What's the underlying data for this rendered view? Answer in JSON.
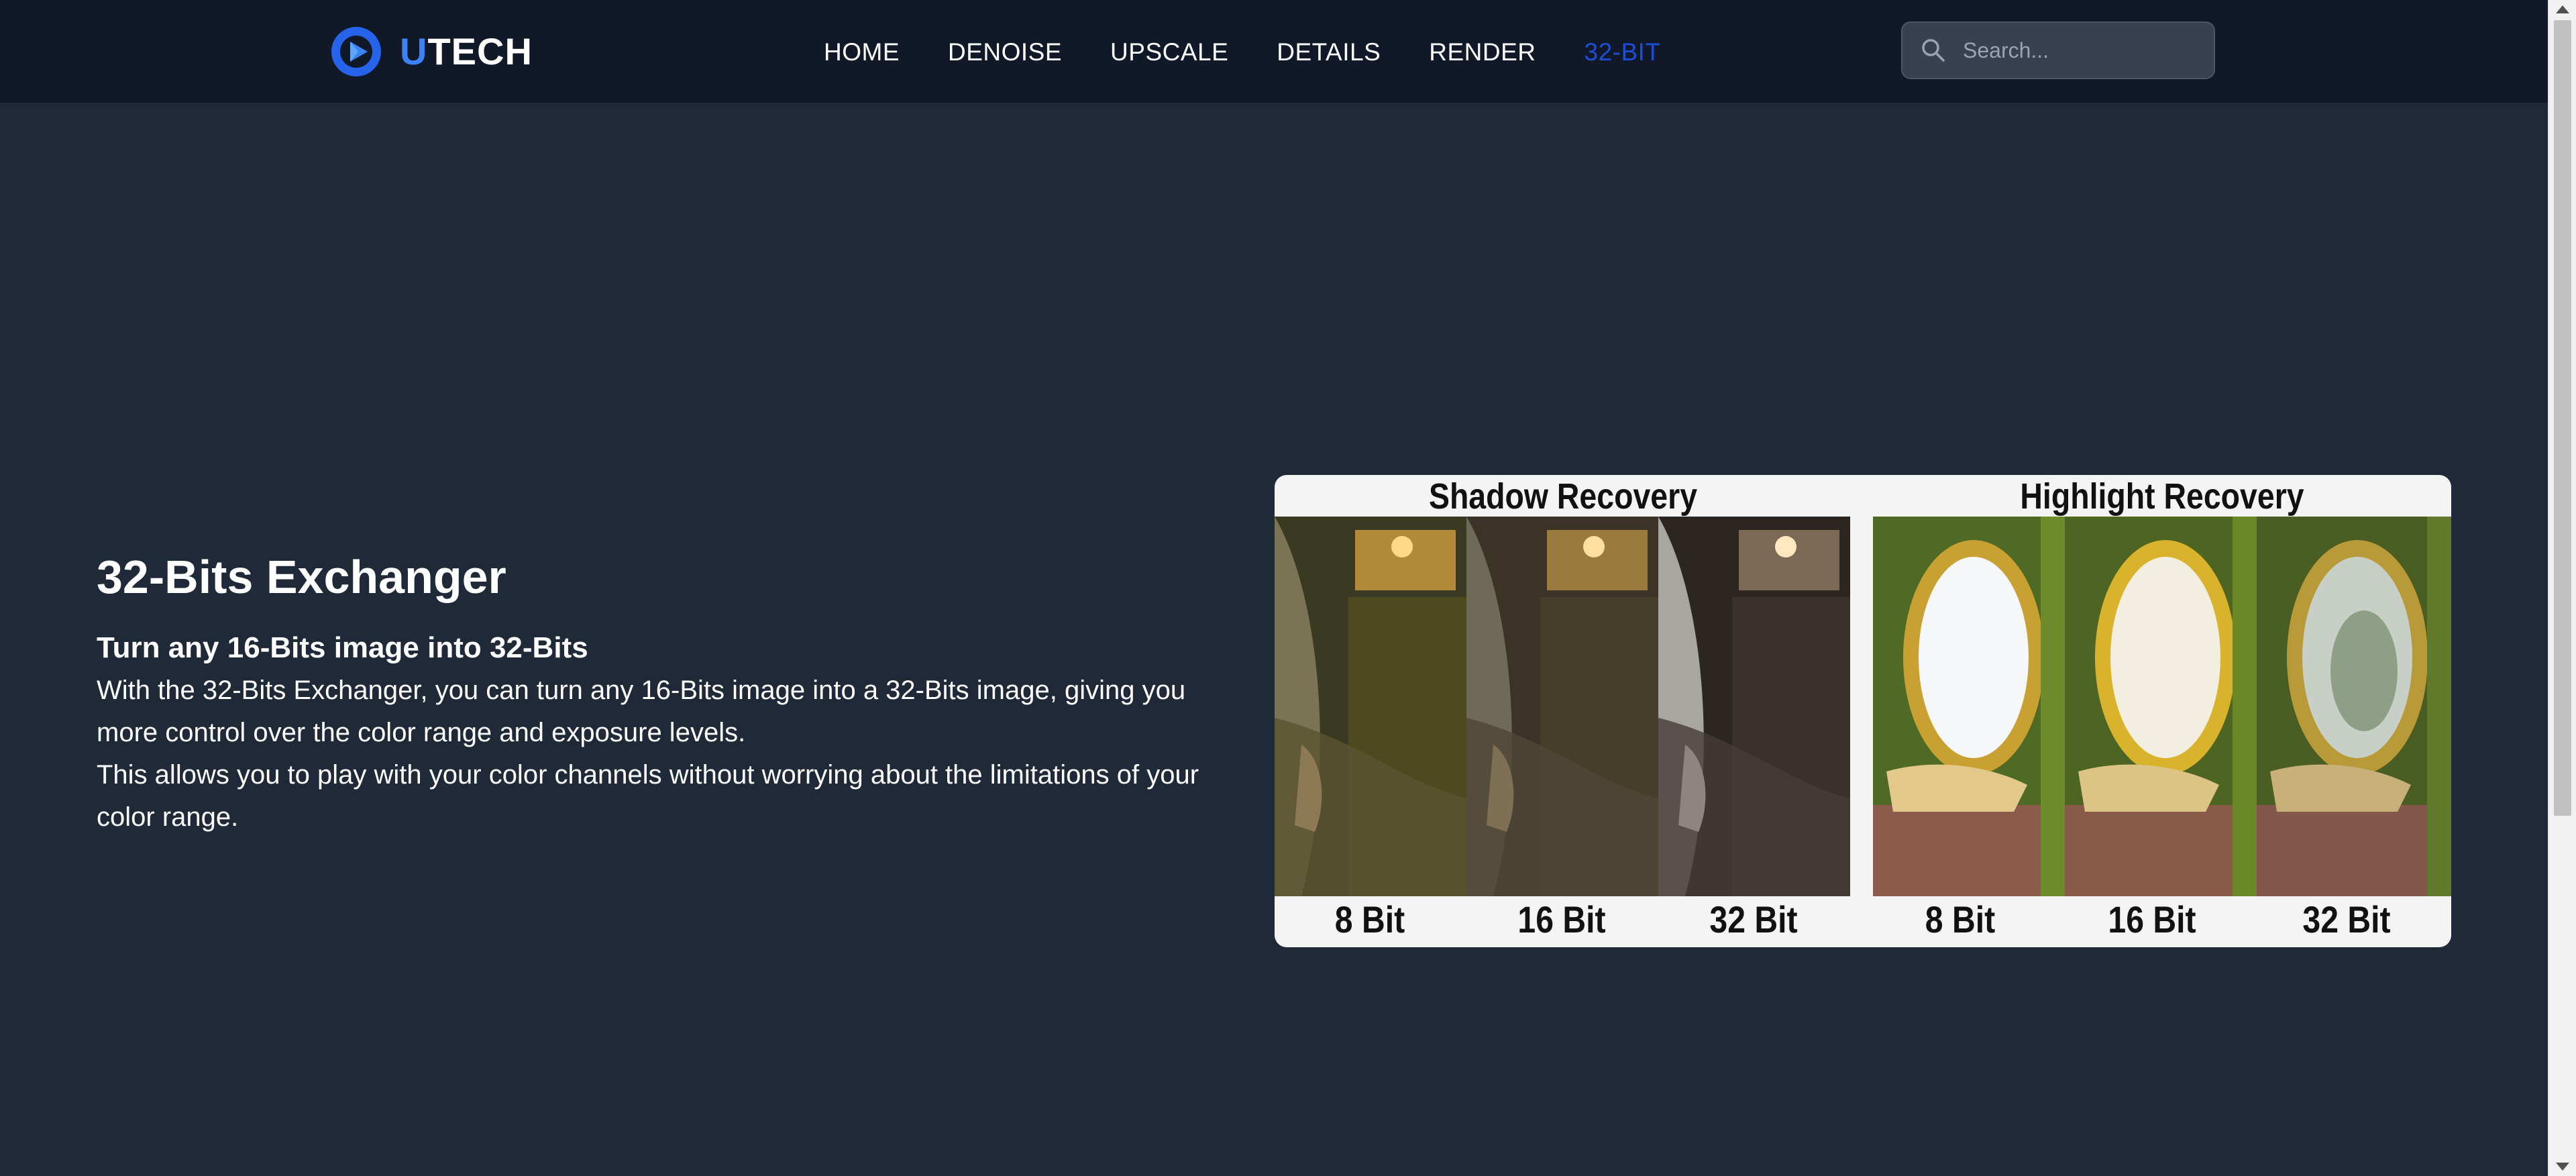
{
  "brand": {
    "initial": "U",
    "rest": "TECH"
  },
  "nav": {
    "items": [
      {
        "label": "HOME"
      },
      {
        "label": "DENOISE"
      },
      {
        "label": "UPSCALE"
      },
      {
        "label": "DETAILS"
      },
      {
        "label": "RENDER"
      },
      {
        "label": "32-BIT",
        "active": true
      }
    ]
  },
  "search": {
    "placeholder": "Search..."
  },
  "hero": {
    "title": "32-Bits Exchanger",
    "subtitle": "Turn any 16-Bits image into 32-Bits",
    "paragraph1": "With the 32-Bits Exchanger, you can turn any 16-Bits image into a 32-Bits image, giving you more control over the color range and exposure levels.",
    "paragraph2": "This allows you to play with your color channels without worrying about the limitations of your color range."
  },
  "figure": {
    "left_heading": "Shadow Recovery",
    "right_heading": "Highlight Recovery",
    "labels": [
      "8 Bit",
      "16 Bit",
      "32 Bit",
      "8 Bit",
      "16 Bit",
      "32 Bit"
    ]
  },
  "colors": {
    "page_bg": "#1f2937",
    "header_bg": "#111827",
    "accent": "#3b82f6",
    "active_nav": "#1d4ed8"
  }
}
